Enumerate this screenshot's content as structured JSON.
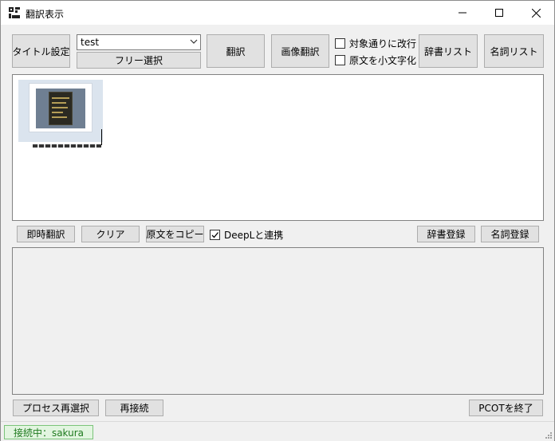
{
  "window": {
    "title": "翻訳表示"
  },
  "toolbar": {
    "title_setting": "タイトル設定",
    "combo_value": "test",
    "free_select": "フリー選択",
    "translate": "翻訳",
    "image_translate": "画像翻訳",
    "linebreak_label": "対象通りに改行",
    "lowercase_label": "原文を小文字化",
    "dict_list": "辞書リスト",
    "noun_list": "名詞リスト"
  },
  "actions": {
    "instant_translate": "即時翻訳",
    "clear": "クリア",
    "copy_original": "原文をコピー",
    "deepl_label": "DeepLと連携",
    "dict_register": "辞書登録",
    "noun_register": "名詞登録"
  },
  "bottom": {
    "reselect_process": "プロセス再選択",
    "reconnect": "再接続",
    "quit": "PCOTを終了"
  },
  "status": {
    "text": "接続中：sakura"
  },
  "checks": {
    "linebreak": false,
    "lowercase": false,
    "deepl": true
  },
  "icons": [
    "app-icon",
    "minimize-icon",
    "maximize-icon",
    "close-icon",
    "chevron-down-icon",
    "checkmark-icon",
    "resize-grip-icon"
  ]
}
